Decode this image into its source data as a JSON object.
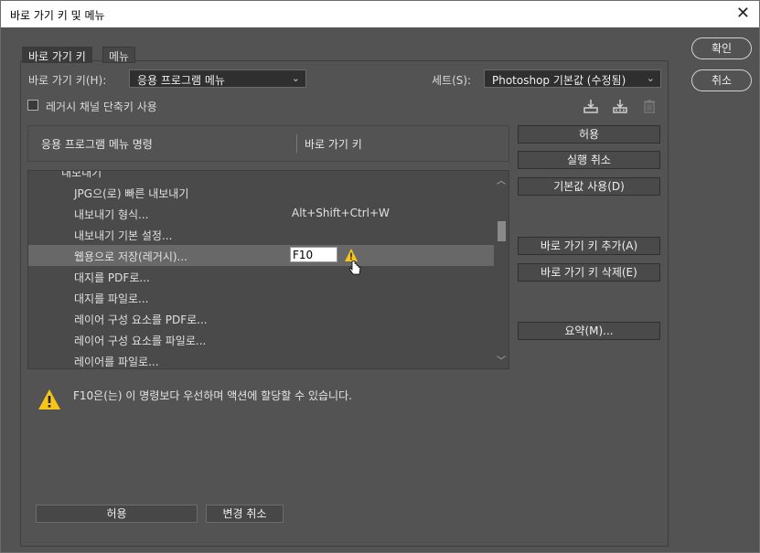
{
  "window": {
    "title": "바로 가기 키 및 메뉴",
    "close": "✕"
  },
  "tabs": [
    {
      "label": "바로 가기 키"
    },
    {
      "label": "메뉴"
    }
  ],
  "shortcut_for": {
    "label": "바로 가기 키(H):",
    "value": "응용 프로그램 메뉴"
  },
  "set": {
    "label": "세트(S):",
    "value": "Photoshop 기본값 (수정됨)"
  },
  "legacy_checkbox": {
    "label": "레거시 채널 단축키 사용",
    "checked": false
  },
  "table": {
    "col_command": "응용 프로그램 메뉴 명령",
    "col_shortcut": "바로 가기 키",
    "partial_top_row": "내보내기",
    "rows": [
      {
        "name": "JPG으(로) 빠른 내보내기",
        "shortcut": ""
      },
      {
        "name": "내보내기 형식...",
        "shortcut": "Alt+Shift+Ctrl+W"
      },
      {
        "name": "내보내기 기본 설정...",
        "shortcut": ""
      },
      {
        "name": "웹용으로 저장(레거시)...",
        "shortcut": "F10",
        "selected": true
      },
      {
        "name": "대지를 PDF로...",
        "shortcut": ""
      },
      {
        "name": "대지를 파일로...",
        "shortcut": ""
      },
      {
        "name": "레이어 구성 요소를 PDF로...",
        "shortcut": ""
      },
      {
        "name": "레이어 구성 요소를 파일로...",
        "shortcut": ""
      },
      {
        "name": "레이어를 파일로...",
        "shortcut": ""
      }
    ]
  },
  "side_buttons": {
    "accept": "허용",
    "undo": "실행 취소",
    "use_default": "기본값 사용(D)",
    "add_shortcut": "바로 가기 키 추가(A)",
    "delete_shortcut": "바로 가기 키 삭제(E)",
    "summarize": "요약(M)..."
  },
  "warning_message": "F10은(는) 이 명령보다 우선하며 액션에 할당할 수 있습니다.",
  "bottom_buttons": {
    "accept": "허용",
    "undo_changes": "변경 취소"
  },
  "dialog_buttons": {
    "ok": "확인",
    "cancel": "취소"
  },
  "colors": {
    "background": "#535353",
    "warning": "#f5c518",
    "list_bg": "#4a4a4a",
    "selected_row": "#686868"
  }
}
